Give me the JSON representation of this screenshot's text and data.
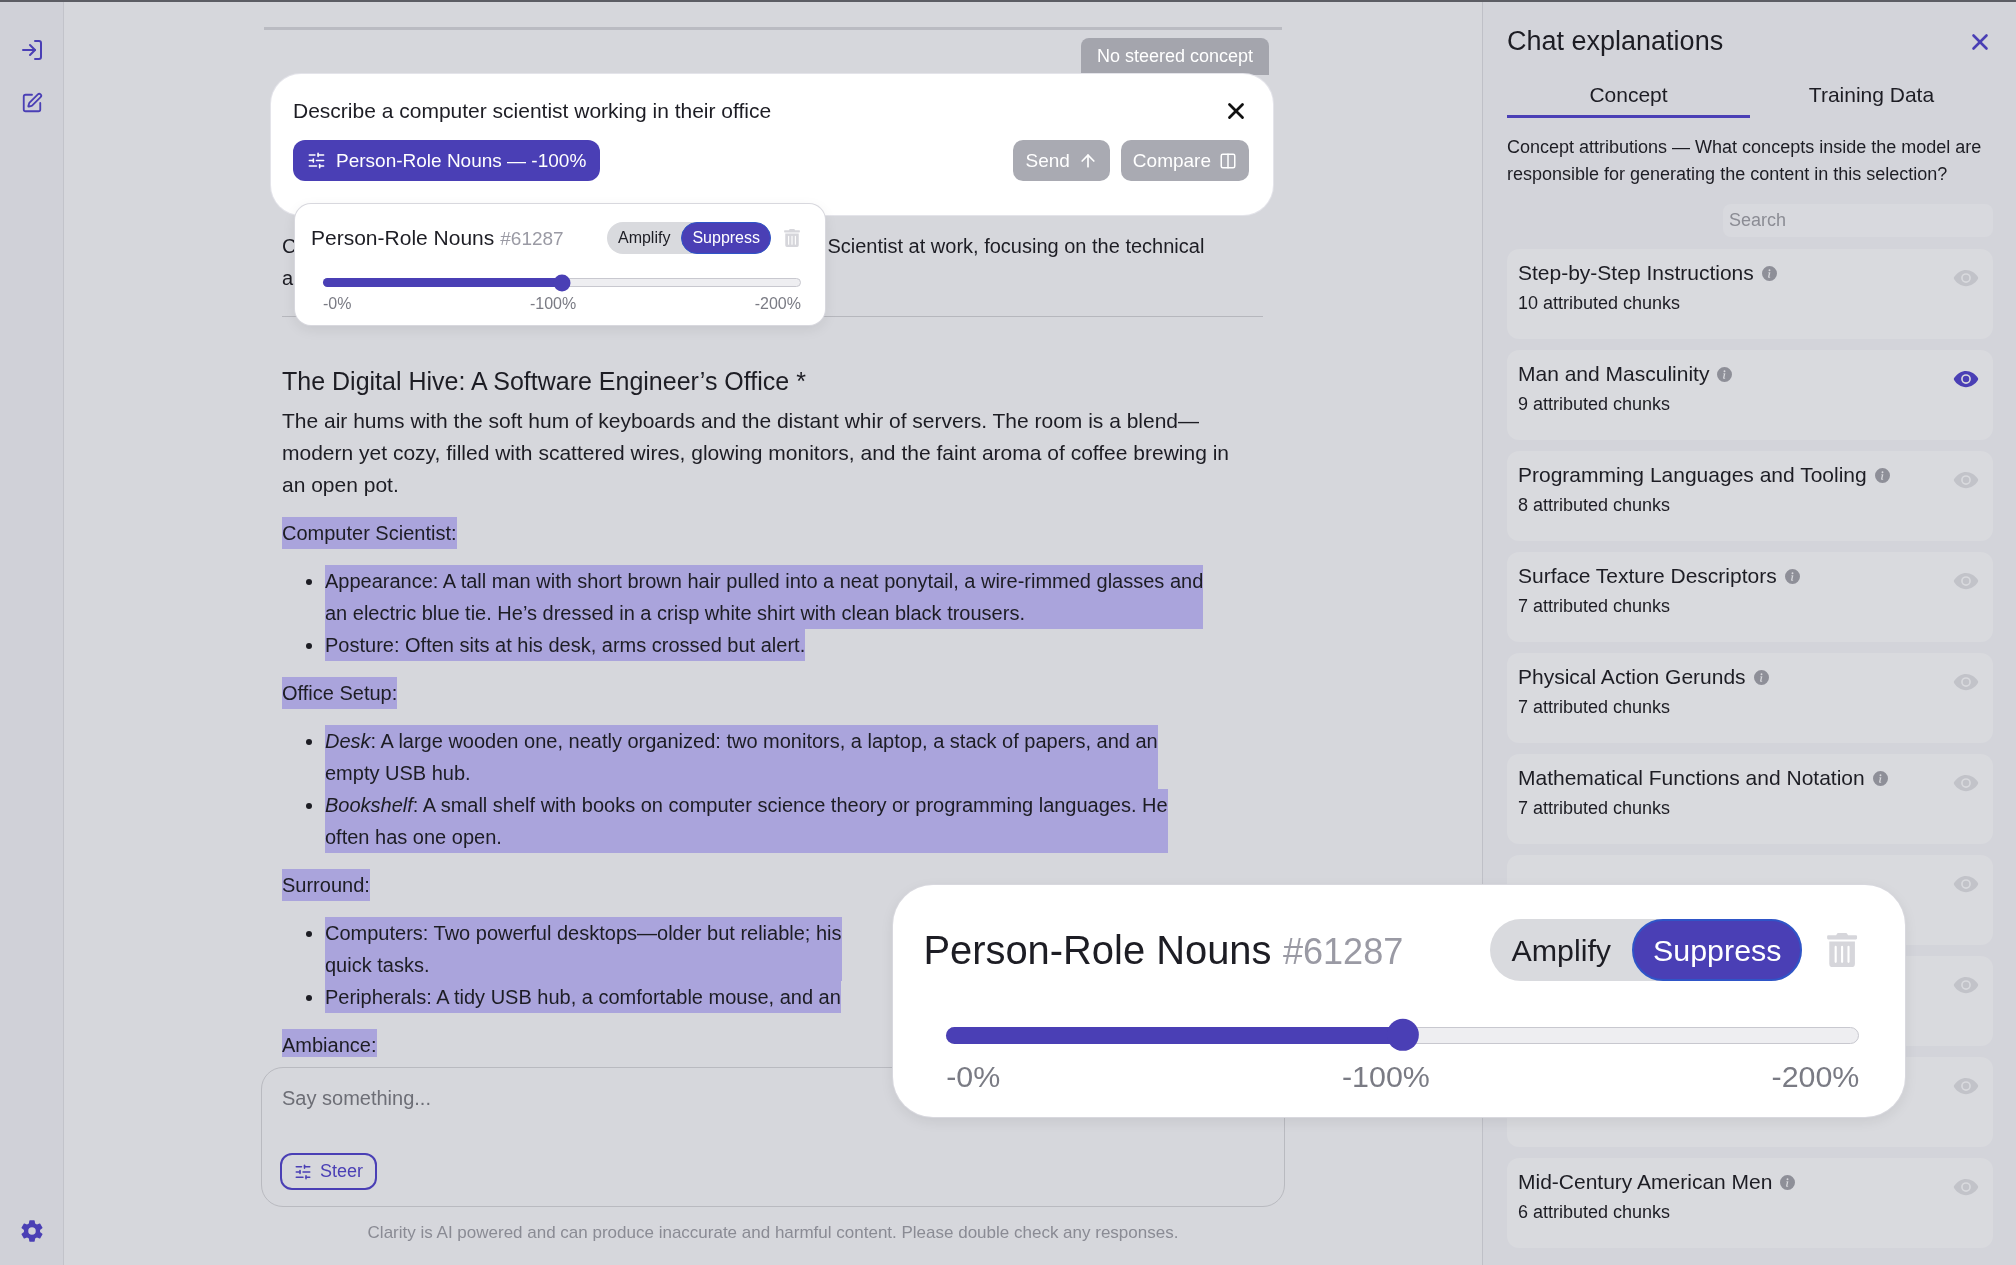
{
  "top_pill": "No steered concept",
  "prompt": {
    "text": "Describe a computer scientist working in their office",
    "chip": "Person-Role Nouns — -100%",
    "buttons": [
      {
        "label": "Send",
        "kind": "send",
        "disabled": true
      },
      {
        "label": "Compare",
        "kind": "compare",
        "disabled": true
      }
    ]
  },
  "steer_popover": {
    "title": "Person-Role Nouns",
    "id": "#61287",
    "modes": [
      {
        "label": "Amplify",
        "selected": false
      },
      {
        "label": "Suppress",
        "selected": true
      }
    ],
    "level": 0.5,
    "ticks": [
      "-0%",
      "-100%",
      "-200%"
    ]
  },
  "response": {
    "intro_lines": [
      {
        "start": "C",
        "end": "Scientist at work, focusing on the technical"
      },
      {
        "start": "a"
      }
    ],
    "heading": "The Digital Hive: A Software Engineer’s Office *",
    "paragraph": "The air hums with the soft hum of keyboards and the distant whir of servers. The room is a blend—modern yet cozy, filled with scattered wires, glowing monitors, and the faint aroma of coffee brewing in an open pot.",
    "sections": [
      {
        "title": "Computer Scientist:",
        "highlighted": true,
        "items": [
          {
            "lines": [
              "Appearance: A tall man with short brown hair pulled into a neat ponytail, a wire-rimmed glasses and",
              "an electric blue tie. He’s dressed in a crisp white shirt with clean black trousers."
            ],
            "highlighted": true
          },
          {
            "lines": [
              "Posture: Often sits at his desk, arms crossed but alert."
            ],
            "highlighted": true
          }
        ]
      },
      {
        "title": "Office Setup:",
        "highlighted": true,
        "items": [
          {
            "lines": [
              "*Desk*: A large wooden one, neatly organized: two monitors, a laptop, a stack of papers, and an",
              "empty USB hub."
            ],
            "highlighted": true
          },
          {
            "lines": [
              "*Bookshelf*: A small shelf with books on computer science theory or programming languages. He",
              "often has one open."
            ],
            "highlighted": true
          }
        ]
      },
      {
        "title": "Surround:",
        "highlighted": true,
        "items": [
          {
            "lines": [
              "Computers: Two powerful desktops—older but reliable; his",
              "quick tasks."
            ],
            "highlighted": true
          },
          {
            "lines": [
              "Peripherals: A tidy USB hub, a comfortable mouse, and an"
            ],
            "highlighted": true
          }
        ]
      },
      {
        "title": "Ambiance:",
        "highlighted": true
      }
    ]
  },
  "composer": {
    "placeholder": "Say something...",
    "steer_button": "Steer"
  },
  "disclaimer": "Clarity is AI powered and can produce inaccurate and harmful content. Please double check any responses.",
  "zoom_callout": {
    "title": "Person-Role Nouns",
    "id": "#61287",
    "modes": [
      {
        "label": "Amplify",
        "selected": false
      },
      {
        "label": "Suppress",
        "selected": true
      }
    ],
    "level": 0.5,
    "ticks": [
      "-0%",
      "-100%",
      "-200%"
    ]
  },
  "explanations": {
    "title": "Chat explanations",
    "tabs": [
      {
        "label": "Concept",
        "selected": true
      },
      {
        "label": "Training Data",
        "selected": false
      }
    ],
    "description": "Concept attributions — What concepts inside the model are responsible for generating the content in this selection?",
    "search": {
      "placeholder": "Search"
    },
    "concepts": [
      {
        "name": "Step-by-Step Instructions",
        "chunks": "10 attributed chunks",
        "viewing": false
      },
      {
        "name": "Man and Masculinity",
        "chunks": "9 attributed chunks",
        "viewing": true
      },
      {
        "name": "Programming Languages and Tooling",
        "chunks": "8 attributed chunks",
        "viewing": false
      },
      {
        "name": "Surface Texture Descriptors",
        "chunks": "7 attributed chunks",
        "viewing": false
      },
      {
        "name": "Physical Action Gerunds",
        "chunks": "7 attributed chunks",
        "viewing": false
      },
      {
        "name": "Mathematical Functions and Notation",
        "chunks": "7 attributed chunks",
        "viewing": false
      },
      {
        "viewing": false
      },
      {
        "viewing": false
      },
      {
        "viewing": false
      },
      {
        "name": "Mid-Century American Men",
        "chunks": "6 attributed chunks",
        "viewing": false
      }
    ]
  }
}
